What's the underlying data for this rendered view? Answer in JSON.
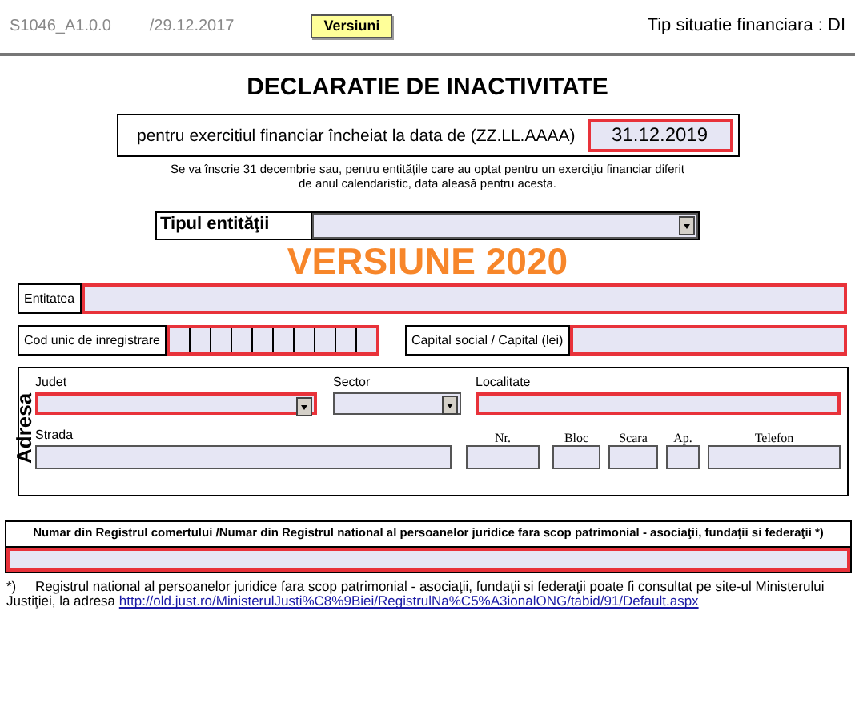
{
  "header": {
    "code": "S1046_A1.0.0",
    "date": "/29.12.2017",
    "version_button": "Versiuni",
    "type_label": "Tip situatie financiara : DI"
  },
  "title": "DECLARATIE DE INACTIVITATE",
  "period": {
    "label": "pentru exercitiul financiar  încheiat la data de (ZZ.LL.AAAA)",
    "value": "31.12.2019",
    "required": true
  },
  "period_note": "Se va înscrie 31 decembrie  sau,  pentru entităţile care au optat pentru un exerciţiu financiar diferit de anul calendaristic, data aleasă pentru acesta.",
  "entity_type": {
    "label": "Tipul entităţii",
    "required": false
  },
  "version_banner": "VERSIUNE 2020",
  "entity": {
    "label": "Entitatea",
    "required": true
  },
  "cui": {
    "label": "Cod unic de inregistrare",
    "required": true
  },
  "capital": {
    "label": "Capital social / Capital  (lei)",
    "required": true
  },
  "address": {
    "label": "Adresa",
    "fields": [
      {
        "label": "Judet",
        "kind": "select",
        "required": true
      },
      {
        "label": "Sector",
        "kind": "select",
        "required": false
      },
      {
        "label": "Localitate",
        "kind": "text",
        "required": true
      },
      {
        "label": "Strada",
        "kind": "text",
        "required": false
      },
      {
        "label": "Nr.",
        "kind": "text",
        "required": false
      },
      {
        "label": "Bloc",
        "kind": "text",
        "required": false
      },
      {
        "label": "Scara",
        "kind": "text",
        "required": false
      },
      {
        "label": "Ap.",
        "kind": "text",
        "required": false
      },
      {
        "label": "Telefon",
        "kind": "text",
        "required": false
      }
    ]
  },
  "registry": {
    "label": "Numar din Registrul comertului /Numar din Registrul national al persoanelor juridice fara scop patrimonial - asociaţii, fundaţii si federaţii *)",
    "required": true
  },
  "footnote": {
    "mark": "*)",
    "text": "Registrul national al persoanelor juridice fara scop patrimonial - asociaţii, fundaţii si federaţii poate fi consultat pe site-ul  Ministerului Justiţiei, la adresa",
    "link": "http://old.just.ro/MinisterulJusti%C8%9Biei/RegistrulNa%C5%A3ionalONG/tabid/91/Default.aspx"
  }
}
